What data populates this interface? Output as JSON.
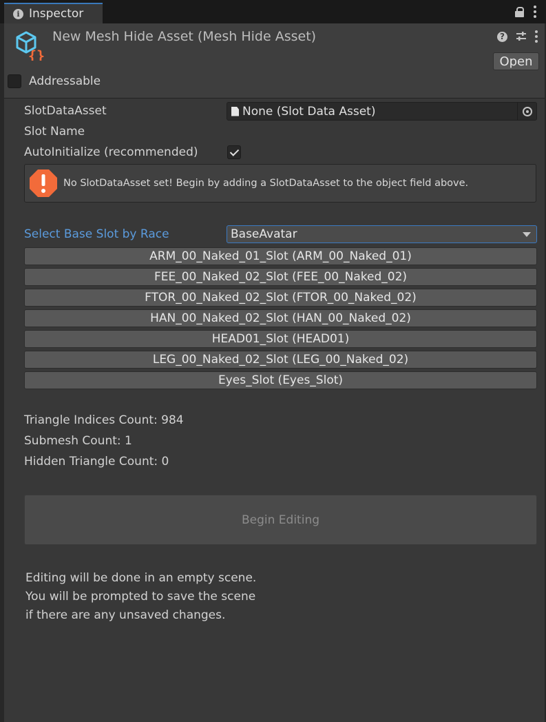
{
  "tab": {
    "label": "Inspector"
  },
  "header": {
    "title": "New Mesh Hide Asset (Mesh Hide Asset)",
    "open_label": "Open",
    "addressable_label": "Addressable"
  },
  "properties": {
    "slot_data_asset_label": "SlotDataAsset",
    "slot_data_asset_value": "None (Slot Data Asset)",
    "slot_name_label": "Slot Name",
    "auto_initialize_label": "AutoInitialize (recommended)",
    "auto_initialize_checked": true
  },
  "warning": {
    "text": "No SlotDataAsset set! Begin by adding a SlotDataAsset to the object field above."
  },
  "race": {
    "label": "Select Base Slot by Race",
    "selected": "BaseAvatar"
  },
  "slots": [
    "ARM_00_Naked_01_Slot (ARM_00_Naked_01)",
    "FEE_00_Naked_02_Slot (FEE_00_Naked_02)",
    "FTOR_00_Naked_02_Slot (FTOR_00_Naked_02)",
    "HAN_00_Naked_02_Slot (HAN_00_Naked_02)",
    "HEAD01_Slot (HEAD01)",
    "LEG_00_Naked_02_Slot (LEG_00_Naked_02)",
    "Eyes_Slot (Eyes_Slot)"
  ],
  "stats": {
    "triangle_indices": "Triangle Indices Count: 984",
    "submesh": "Submesh Count: 1",
    "hidden_triangles": "Hidden Triangle Count: 0"
  },
  "begin_editing_label": "Begin Editing",
  "note_lines": [
    "Editing will be done in an empty scene.",
    "You will be prompted to save the scene",
    "if there are any unsaved changes."
  ],
  "colors": {
    "accent_blue": "#3a79bb",
    "label_blue": "#5b9bdd",
    "warning_orange": "#f26b3a",
    "asset_icon_blue": "#5cc8f0"
  },
  "icons": {
    "tab": "info-icon",
    "lock": "lock-icon",
    "help": "help-icon",
    "settings": "preset-sliders-icon",
    "menu": "kebab-menu-icon",
    "asset": "scriptable-object-icon",
    "warning": "warning-icon",
    "picker": "object-picker-icon"
  }
}
